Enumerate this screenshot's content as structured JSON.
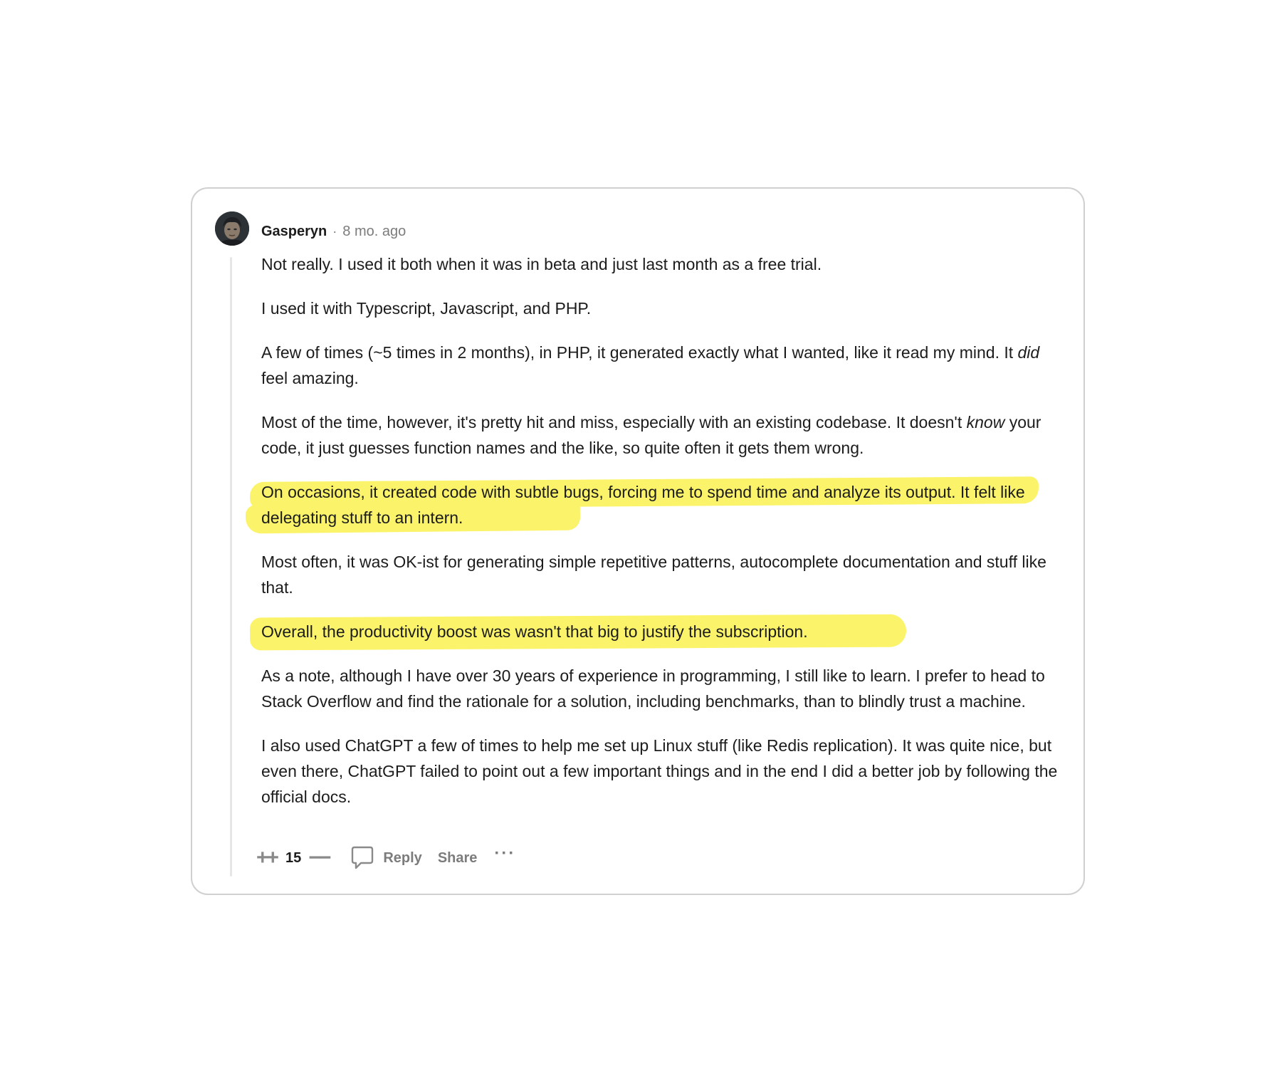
{
  "comment": {
    "author": "Gasperyn",
    "separator": "·",
    "time": "8 mo. ago",
    "paragraphs": {
      "p1": "Not really. I used it both when it was in beta and just last month as a free trial.",
      "p2": "I used it with Typescript, Javascript, and PHP.",
      "p3_a": "A few of times (~5 times in 2 months), in PHP, it generated exactly what I wanted, like it read my mind. It ",
      "p3_em": "did",
      "p3_b": " feel amazing.",
      "p4_a": "Most of the time, however, it's pretty hit and miss, especially with an existing codebase. It doesn't ",
      "p4_em": "know",
      "p4_b": " your code, it just guesses function names and the like, so quite often it gets them wrong.",
      "p5": "On occasions, it created code with subtle bugs, forcing me to spend time and analyze its output. It felt like delegating stuff to an intern.",
      "p6": "Most often, it was OK-ist for generating simple repetitive patterns, autocomplete documentation and stuff like that.",
      "p7": "Overall, the productivity boost was wasn't that big to justify the subscription.",
      "p8": "As a note, although I have over 30 years of experience in programming, I still like to learn. I prefer to head to Stack Overflow and find the rationale for a solution, including benchmarks, than to blindly trust a machine.",
      "p9": "I also used ChatGPT a few of times to help me set up Linux stuff (like Redis replication). It was quite nice, but even there, ChatGPT failed to point out a few important things and in the end I did a better job by following the official docs."
    },
    "highlight_color": "#fbf46b"
  },
  "actions": {
    "upvote": "++",
    "score": "15",
    "downvote": "−−",
    "reply_icon": "comment-bubble-icon",
    "reply_label": "Reply",
    "share_label": "Share",
    "more_label": "···"
  }
}
